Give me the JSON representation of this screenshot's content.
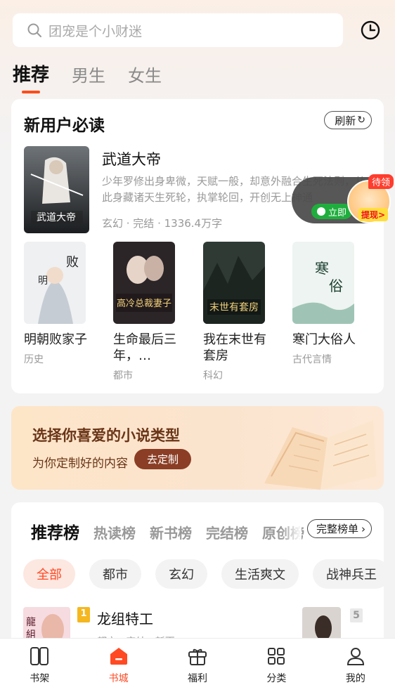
{
  "search": {
    "placeholder": "团宠是个小财迷"
  },
  "icons": {
    "search": "search-icon",
    "history": "clock-icon",
    "refresh": "refresh-icon"
  },
  "tabs": [
    {
      "label": "推荐",
      "active": true
    },
    {
      "label": "男生",
      "active": false
    },
    {
      "label": "女生",
      "active": false
    }
  ],
  "new_user": {
    "title": "新用户必读",
    "refresh_label": "刷新",
    "featured": {
      "title": "武道大帝",
      "desc": "少年罗修出身卑微，天赋一般，却意外融合生死法则，从此身藏诸天生死轮，执掌轮回，开创无上神通",
      "meta": "玄幻 · 完结 · 1336.4万字"
    },
    "books": [
      {
        "title": "明朝败家子",
        "genre": "历史"
      },
      {
        "title": "生命最后三年，…",
        "genre": "都市"
      },
      {
        "title": "我在末世有套房",
        "genre": "科幻"
      },
      {
        "title": "寒门大俗人",
        "genre": "古代言情"
      }
    ]
  },
  "float_widget": {
    "badge": "待领",
    "button": "立即",
    "cash": "提现>"
  },
  "banner": {
    "title": "选择你喜爱的小说类型",
    "subtitle": "为你定制好的内容",
    "button": "去定制"
  },
  "ranking": {
    "tabs": [
      "推荐榜",
      "热读榜",
      "新书榜",
      "完结榜",
      "原创榜"
    ],
    "full_list": "完整榜单",
    "chips": [
      "全部",
      "都市",
      "玄幻",
      "生活爽文",
      "战神兵王"
    ],
    "item1": {
      "rank": "1",
      "title": "龙组特工",
      "meta": "都市 · 完结 · 新更"
    },
    "item2": {
      "rank": "5"
    }
  },
  "nav": [
    {
      "label": "书架",
      "icon": "bookshelf-icon"
    },
    {
      "label": "书城",
      "icon": "bookstore-icon",
      "active": true
    },
    {
      "label": "福利",
      "icon": "gift-icon"
    },
    {
      "label": "分类",
      "icon": "category-icon"
    },
    {
      "label": "我的",
      "icon": "profile-icon"
    }
  ],
  "colors": {
    "accent": "#ff4a24",
    "banner_brown": "#8b3e25"
  }
}
